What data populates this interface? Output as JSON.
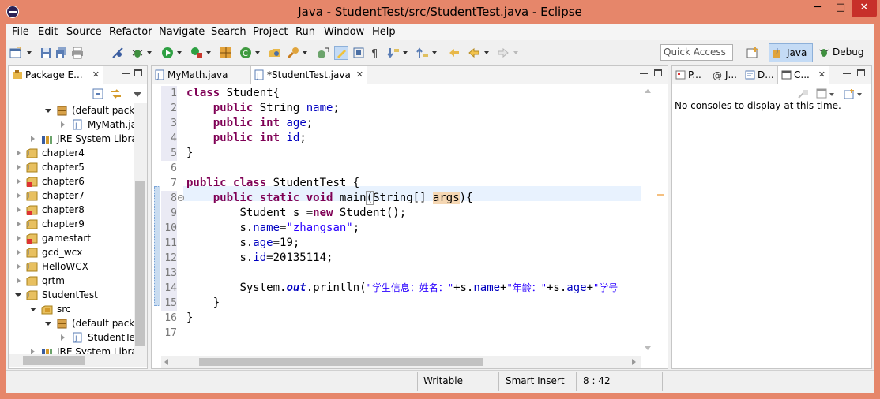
{
  "window": {
    "title": "Java - StudentTest/src/StudentTest.java - Eclipse",
    "minimize": "─",
    "maximize": "□",
    "close": "✕"
  },
  "menu": [
    "File",
    "Edit",
    "Source",
    "Refactor",
    "Navigate",
    "Search",
    "Project",
    "Run",
    "Window",
    "Help"
  ],
  "toolbar": {
    "quick_access_placeholder": "Quick Access",
    "perspectives": [
      {
        "label": "Java",
        "icon": "java-perspective-icon",
        "active": true
      },
      {
        "label": "Debug",
        "icon": "debug-bug-icon",
        "active": false
      }
    ]
  },
  "package_explorer": {
    "tab_label": "Package E...",
    "items": [
      {
        "label": "(default pack",
        "icon": "package-icon",
        "expanded": true
      },
      {
        "label": "MyMath.ja",
        "icon": "java-file-icon",
        "expanded": false
      },
      {
        "label": "JRE System Libra",
        "icon": "library-icon",
        "expanded": false
      },
      {
        "label": "chapter4",
        "icon": "project-folder-icon",
        "expanded": false
      },
      {
        "label": "chapter5",
        "icon": "project-folder-icon",
        "expanded": false
      },
      {
        "label": "chapter6",
        "icon": "project-folder-error-icon",
        "expanded": false
      },
      {
        "label": "chapter7",
        "icon": "project-folder-icon",
        "expanded": false
      },
      {
        "label": "chapter8",
        "icon": "project-folder-error-icon",
        "expanded": false
      },
      {
        "label": "chapter9",
        "icon": "project-folder-icon",
        "expanded": false
      },
      {
        "label": "gamestart",
        "icon": "project-folder-error-icon",
        "expanded": false
      },
      {
        "label": "gcd_wcx",
        "icon": "project-folder-icon",
        "expanded": false
      },
      {
        "label": "HelloWCX",
        "icon": "project-folder-icon",
        "expanded": false
      },
      {
        "label": "qrtm",
        "icon": "project-folder-icon",
        "expanded": false
      },
      {
        "label": "StudentTest",
        "icon": "project-folder-icon",
        "expanded": true
      },
      {
        "label": "src",
        "icon": "source-folder-icon",
        "expanded": true
      },
      {
        "label": "(default pack",
        "icon": "package-icon",
        "expanded": true
      },
      {
        "label": "StudentTe",
        "icon": "java-file-icon",
        "expanded": false
      },
      {
        "label": "JRE System Libra",
        "icon": "library-icon",
        "expanded": false
      }
    ]
  },
  "editor": {
    "tabs": [
      {
        "label": "MyMath.java",
        "active": false
      },
      {
        "label": "*StudentTest.java",
        "active": true
      }
    ],
    "tab_close": "✕",
    "line_numbers": [
      "1",
      "2",
      "3",
      "4",
      "5",
      "6",
      "7",
      "8",
      "9",
      "10",
      "11",
      "12",
      "13",
      "14",
      "15",
      "16",
      "17"
    ],
    "code": {
      "l1": [
        "class",
        " Student{"
      ],
      "l2": [
        "public",
        "String",
        "name"
      ],
      "l3": [
        "public",
        "int",
        "age"
      ],
      "l4": [
        "public",
        "int",
        "id"
      ],
      "l5": "}",
      "l7": [
        "public",
        "class",
        " StudentTest {"
      ],
      "l8": [
        "public",
        "static",
        "void",
        " main",
        "(",
        "String[] ",
        "args",
        "){"
      ],
      "l9": [
        "Student s =",
        "new",
        " Student();"
      ],
      "l10": [
        "s.",
        "name",
        "=",
        "\"zhangsan\"",
        ";"
      ],
      "l11": [
        "s.",
        "age",
        "=19;"
      ],
      "l12": [
        "s.",
        "id",
        "=20135114;"
      ],
      "l14": [
        "System.",
        "out",
        ".println(",
        "\"学生信息：姓名：\"",
        "+s.",
        "name",
        "+",
        "\"年龄：\"",
        "+s.",
        "age",
        "+",
        "\"学号"
      ],
      "l15": "}",
      "l16": "}"
    }
  },
  "side_panel": {
    "tabs": [
      "P...",
      "J...",
      "D...",
      "C..."
    ],
    "message": "No consoles to display at this time."
  },
  "status": {
    "writable": "Writable",
    "insert_mode": "Smart Insert",
    "position": "8 : 42"
  }
}
